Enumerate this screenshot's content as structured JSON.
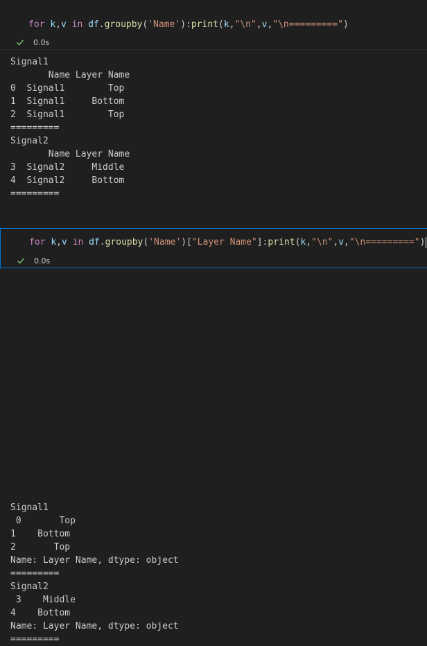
{
  "cells": [
    {
      "code_tokens": [
        {
          "t": "for",
          "c": "kw"
        },
        {
          "t": " ",
          "c": "plain"
        },
        {
          "t": "k",
          "c": "var"
        },
        {
          "t": ",",
          "c": "plain"
        },
        {
          "t": "v",
          "c": "var"
        },
        {
          "t": " ",
          "c": "plain"
        },
        {
          "t": "in",
          "c": "kw"
        },
        {
          "t": " ",
          "c": "plain"
        },
        {
          "t": "df",
          "c": "var"
        },
        {
          "t": ".",
          "c": "plain"
        },
        {
          "t": "groupby",
          "c": "fn"
        },
        {
          "t": "(",
          "c": "plain"
        },
        {
          "t": "'Name'",
          "c": "str"
        },
        {
          "t": "):",
          "c": "plain"
        },
        {
          "t": "print",
          "c": "fn"
        },
        {
          "t": "(",
          "c": "plain"
        },
        {
          "t": "k",
          "c": "var"
        },
        {
          "t": ",",
          "c": "plain"
        },
        {
          "t": "\"\\n\"",
          "c": "str"
        },
        {
          "t": ",",
          "c": "plain"
        },
        {
          "t": "v",
          "c": "var"
        },
        {
          "t": ",",
          "c": "plain"
        },
        {
          "t": "\"\\n=========\"",
          "c": "str"
        },
        {
          "t": ")",
          "c": "plain"
        }
      ],
      "status": "0.0s",
      "output_lines": [
        "Signal1",
        "       Name Layer Name",
        "0  Signal1        Top",
        "1  Signal1     Bottom",
        "2  Signal1        Top",
        "=========",
        "Signal2",
        "       Name Layer Name",
        "3  Signal2     Middle",
        "4  Signal2     Bottom",
        "========="
      ]
    },
    {
      "code_tokens": [
        {
          "t": "for",
          "c": "kw"
        },
        {
          "t": " ",
          "c": "plain"
        },
        {
          "t": "k",
          "c": "var"
        },
        {
          "t": ",",
          "c": "plain"
        },
        {
          "t": "v",
          "c": "var"
        },
        {
          "t": " ",
          "c": "plain"
        },
        {
          "t": "in",
          "c": "kw"
        },
        {
          "t": " ",
          "c": "plain"
        },
        {
          "t": "df",
          "c": "var"
        },
        {
          "t": ".",
          "c": "plain"
        },
        {
          "t": "groupby",
          "c": "fn"
        },
        {
          "t": "(",
          "c": "plain"
        },
        {
          "t": "'Name'",
          "c": "str"
        },
        {
          "t": ")[",
          "c": "plain"
        },
        {
          "t": "\"Layer Name\"",
          "c": "str"
        },
        {
          "t": "]:",
          "c": "plain"
        },
        {
          "t": "print",
          "c": "fn"
        },
        {
          "t": "(",
          "c": "plain"
        },
        {
          "t": "k",
          "c": "var"
        },
        {
          "t": ",",
          "c": "plain"
        },
        {
          "t": "\"\\n\"",
          "c": "str"
        },
        {
          "t": ",",
          "c": "plain"
        },
        {
          "t": "v",
          "c": "var"
        },
        {
          "t": ",",
          "c": "plain"
        },
        {
          "t": "\"\\n=========\"",
          "c": "str"
        },
        {
          "t": ")",
          "c": "plain"
        }
      ],
      "status": "0.0s",
      "output_lines": [
        "Signal1",
        " 0       Top",
        "1    Bottom",
        "2       Top",
        "Name: Layer Name, dtype: object",
        "=========",
        "Signal2",
        " 3    Middle",
        "4    Bottom",
        "Name: Layer Name, dtype: object",
        "========="
      ]
    }
  ],
  "icons": {
    "status_icon": "check-icon"
  },
  "colors": {
    "background": "#1f1f1f",
    "selected_border": "#0078d4",
    "keyword": "#c586c0",
    "variable": "#9cdcfe",
    "function": "#dcdcaa",
    "string": "#ce9178",
    "success_check": "#89d185"
  }
}
